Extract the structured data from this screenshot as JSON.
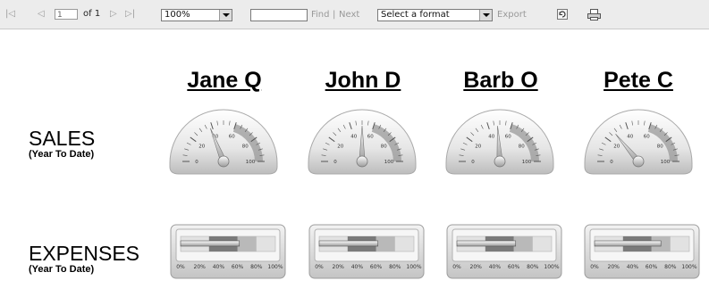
{
  "toolbar": {
    "first_glyph": "|◁",
    "prev_glyph": "◁",
    "page_current": "1",
    "page_of": "of 1",
    "next_glyph": "▷",
    "last_glyph": "▷|",
    "zoom": "100%",
    "find_value": "",
    "find_label": "Find",
    "separator": "|",
    "next_label": "Next",
    "format_select": "Select a format",
    "export_label": "Export"
  },
  "people": [
    {
      "name": "Jane Q",
      "sales_value": 38,
      "expenses_pct": 62
    },
    {
      "name": "John D",
      "sales_value": 50,
      "expenses_pct": 62
    },
    {
      "name": "Barb O",
      "sales_value": 48,
      "expenses_pct": 62
    },
    {
      "name": "Pete C",
      "sales_value": 28,
      "expenses_pct": 70
    }
  ],
  "rows": {
    "sales": {
      "label": "SALES",
      "sub": "(Year To Date)"
    },
    "expenses": {
      "label": "EXPENSES",
      "sub": "(Year To Date)"
    }
  },
  "gauge_ticks": [
    "0",
    "20",
    "40",
    "60",
    "80",
    "100"
  ],
  "bar_ticks": [
    "0%",
    "20%",
    "40%",
    "60%",
    "80%",
    "100%"
  ],
  "colors": {
    "accent_range": "#9a9a9a",
    "band_dark": "#7a7a7a",
    "band_mid": "#b9b9b9",
    "band_light": "#e2e2e2"
  }
}
